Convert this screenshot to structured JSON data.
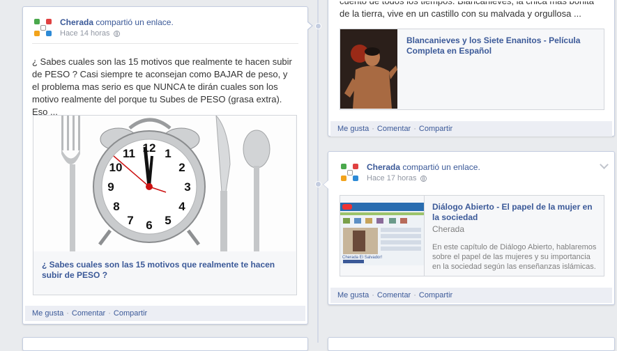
{
  "left_post": {
    "author": "Cherada",
    "action": "compartió un enlace.",
    "time": "Hace 14 horas",
    "text": "¿ Sabes cuales son las 15 motivos que realmente te hacen subir de PESO ? Casi siempre te aconsejan como BAJAR de peso, y el problema mas serio es que NUNCA te dirán cuales son los motivo realmente del porque tu Subes de PESO (grasa extra). Eso ...",
    "link_title": "¿ Sabes cuales son las 15 motivos que realmente te hacen subir de PESO ?",
    "actions": {
      "like": "Me gusta",
      "comment": "Comentar",
      "share": "Compartir"
    }
  },
  "right_top_post": {
    "text_partial": "cuento de todos los tiempos. Blancanieves, la chica mas bonita de la tierra, vive en un castillo con su malvada y orgullosa ...",
    "link_title": "Blancanieves y los Siete Enanitos - Película Completa en Español",
    "actions": {
      "like": "Me gusta",
      "comment": "Comentar",
      "share": "Compartir"
    }
  },
  "right_mid_post": {
    "author": "Cherada",
    "action": "compartió un enlace.",
    "time": "Hace 17 horas",
    "link_title": "Diálogo Abierto - El papel de la mujer en la sociedad",
    "link_source": "Cherada",
    "link_description": "En este capítulo de Diálogo Abierto, hablaremos sobre el papel de las mujeres y su importancia en la sociedad según las enseñanzas islámicas.",
    "thumb_caption": "Cherada El Salvador!",
    "actions": {
      "like": "Me gusta",
      "comment": "Comentar",
      "share": "Compartir"
    }
  },
  "colors": {
    "link": "#3b5998",
    "meta": "#9197a3",
    "background": "#e9ebee",
    "footer": "#eceef4"
  }
}
